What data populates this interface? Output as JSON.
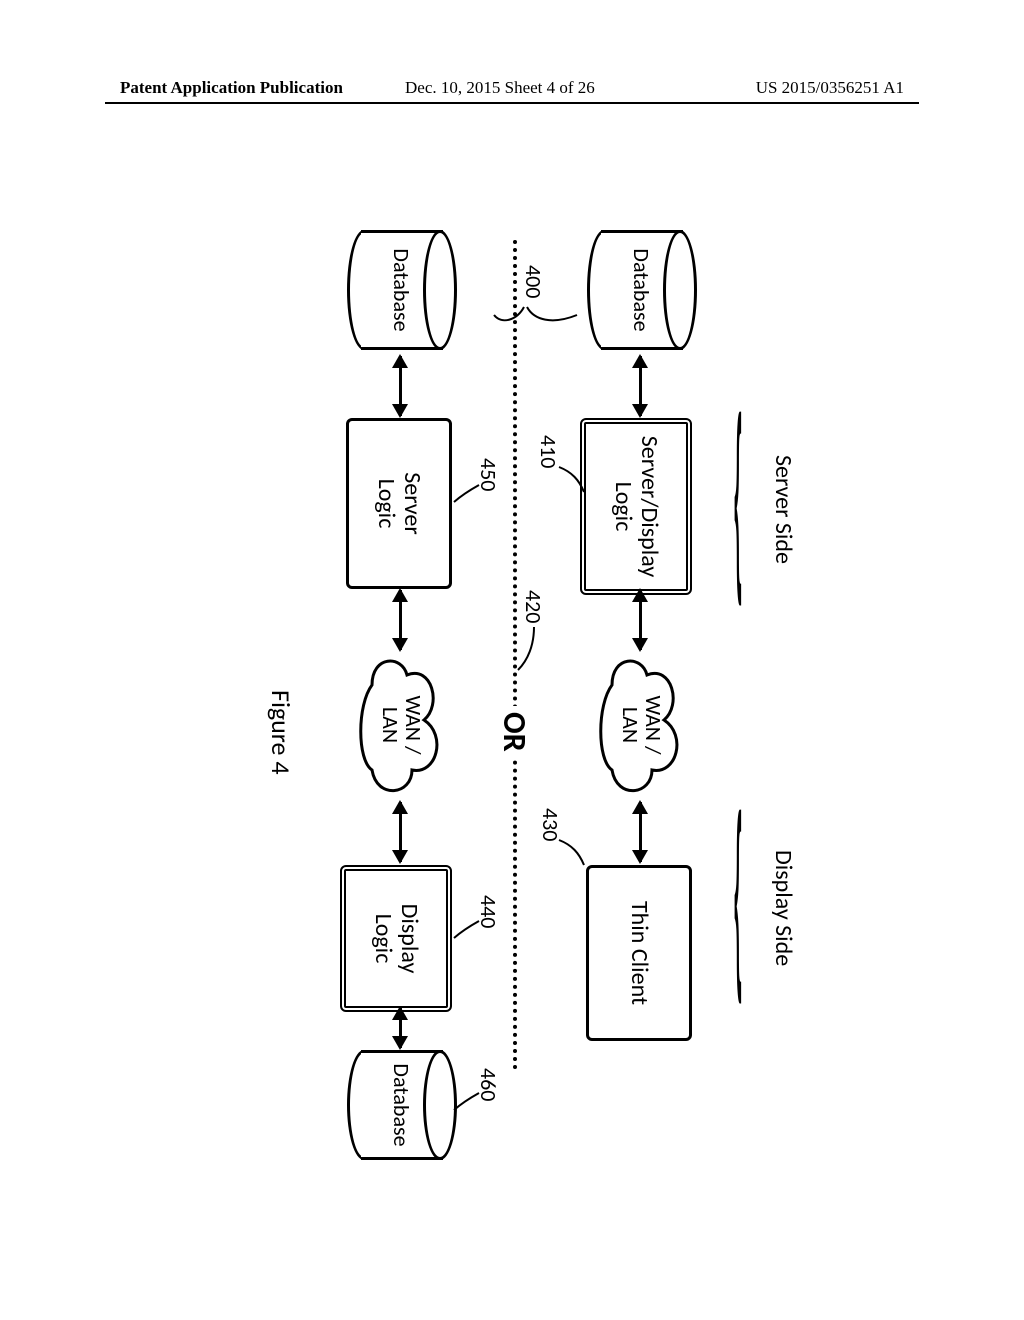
{
  "header": {
    "left": "Patent Application Publication",
    "center": "Dec. 10, 2015  Sheet 4 of 26",
    "right": "US 2015/0356251 A1"
  },
  "figure_caption": "Figure 4",
  "labels": {
    "server_side": "Server Side",
    "display_side": "Display Side"
  },
  "top": {
    "db": "Database",
    "box": "Server/Display\nLogic",
    "cloud": "WAN /\nLAN",
    "client": "Thin Client"
  },
  "bottom": {
    "db_left": "Database",
    "server": "Server\nLogic",
    "cloud": "WAN /\nLAN",
    "display": "Display\nLogic",
    "db_right": "Database"
  },
  "refs": {
    "r400": "400",
    "r410": "410",
    "r420": "420",
    "r430": "430",
    "r440": "440",
    "r450": "450",
    "r460": "460"
  },
  "or_text": "OR"
}
